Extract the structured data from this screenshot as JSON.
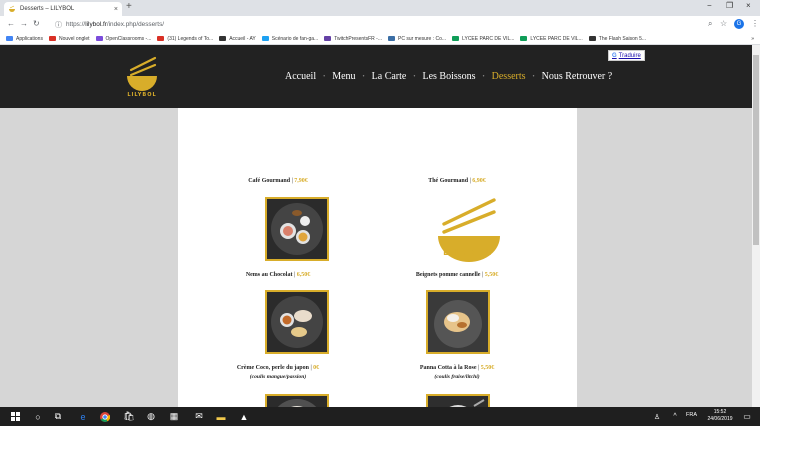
{
  "browser": {
    "tab_title": "Desserts – LILYBOL",
    "tab_close": "×",
    "new_tab": "+",
    "url_scheme": "https://",
    "url_host": "lilybol.fr",
    "url_rest": "/index.php/desserts/",
    "window_minimize": "−",
    "window_maximize": "❐",
    "window_close": "×",
    "profile_initial": "G"
  },
  "bookmarks": [
    {
      "label": "Applications",
      "color": "#4285f4"
    },
    {
      "label": "Nouvel onglet",
      "color": "#d93025"
    },
    {
      "label": "OpenClassrooms -...",
      "color": "#7b4cdb"
    },
    {
      "label": "(31) Legends of To...",
      "color": "#d93025"
    },
    {
      "label": "Accueil - AY",
      "color": "#333333"
    },
    {
      "label": "Scénario de fan-ga...",
      "color": "#1da1f2"
    },
    {
      "label": "TwitchPresentsFR -...",
      "color": "#6441a5"
    },
    {
      "label": "PC sur mesure : Co...",
      "color": "#3b6ea5"
    },
    {
      "label": "LYCEE PARC DE VIL...",
      "color": "#0f9d58"
    },
    {
      "label": "LYCEE PARC DE VIL...",
      "color": "#0f9d58"
    },
    {
      "label": "The Flash Saison 5...",
      "color": "#333333"
    }
  ],
  "bookmarks_more": "»",
  "site": {
    "brand": "LILYBOL",
    "translate_label": "Traduire",
    "translate_g": "G",
    "menu": [
      "Accueil",
      "Menu",
      "La Carte",
      "Les Boissons",
      "Desserts",
      "Nous Retrouver ?"
    ],
    "menu_separator": "•",
    "active_menu_index": 4,
    "accent_color": "#d8ad2a"
  },
  "desserts": [
    {
      "name": "Café Gourmand",
      "price": "7,90€",
      "sub": ""
    },
    {
      "name": "Thé Gourmand",
      "price": "6,90€",
      "sub": ""
    },
    {
      "name": "Nems au Chocolat",
      "price": "6,50€",
      "sub": ""
    },
    {
      "name": "Beignets pomme cannelle",
      "price": "5,50€",
      "sub": ""
    },
    {
      "name": "Crème Coco, perle du japon",
      "price": "0€",
      "sub": "(coulis mangue/passion)"
    },
    {
      "name": "Panna Cotta à la Rose",
      "price": "5,50€",
      "sub": "(coulis fraise/litchi)"
    }
  ],
  "price_separator": "|",
  "taskbar": {
    "language": "FRA",
    "time": "15:52",
    "date": "24/06/2019"
  }
}
